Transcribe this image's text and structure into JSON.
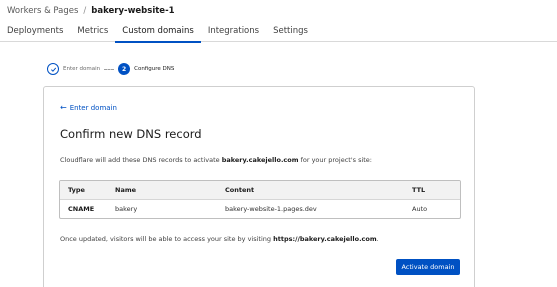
{
  "breadcrumb": {
    "parent": "Workers & Pages",
    "separator": "/",
    "current": "bakery-website-1"
  },
  "tabs": [
    {
      "label": "Deployments"
    },
    {
      "label": "Metrics"
    },
    {
      "label": "Custom domains",
      "active": true
    },
    {
      "label": "Integrations"
    },
    {
      "label": "Settings"
    }
  ],
  "stepper": {
    "steps": [
      {
        "label": "Enter domain",
        "state": "done",
        "icon": "check-icon"
      },
      {
        "label": "Configure DNS",
        "state": "current",
        "number": "2"
      }
    ]
  },
  "card": {
    "back_link": "Enter domain",
    "title": "Confirm new DNS record",
    "description_prefix": "Cloudflare will add these DNS records to activate ",
    "description_domain": "bakery.cakejello.com",
    "description_suffix": " for your project's site:",
    "table": {
      "headers": [
        "Type",
        "Name",
        "Content",
        "TTL"
      ],
      "rows": [
        [
          "CNAME",
          "bakery",
          "bakery-website-1.pages.dev",
          "Auto"
        ]
      ]
    },
    "footer_prefix": "Once updated, visitors will be able to access your site by visiting ",
    "footer_url": "https://bakery.cakejello.com",
    "footer_suffix": ".",
    "primary_button": "Activate domain"
  },
  "colors": {
    "accent": "#0051c3",
    "border": "#cfcfcf",
    "table_header_bg": "#f2f2f2"
  }
}
